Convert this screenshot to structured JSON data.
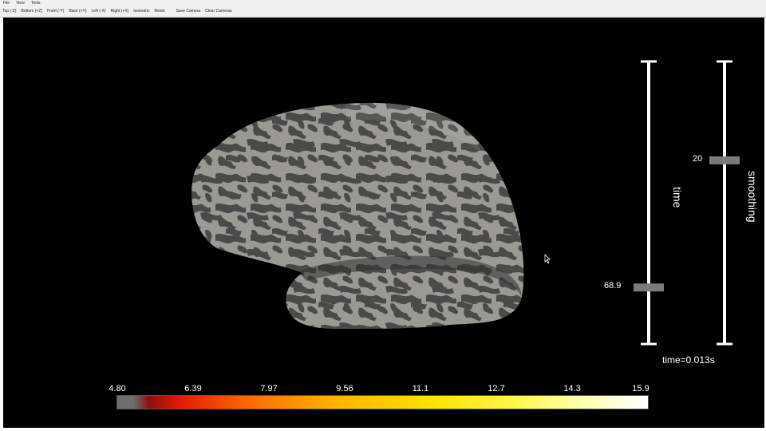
{
  "menu": [
    "File",
    "View",
    "Tools"
  ],
  "toolbar": [
    "Top (-Z)",
    "Bottom (+Z)",
    "Front (-Y)",
    "Back (+Y)",
    "Left (-X)",
    "Right (+X)",
    "Isometric",
    "Reset",
    "Save Camera",
    "Clear Cameras"
  ],
  "sliders": {
    "time": {
      "title": "time",
      "value_label": "68.9",
      "level": 0.2
    },
    "smoothing": {
      "title": "smoothing",
      "value_label": "20",
      "level": 0.65
    }
  },
  "time_text": "time=0.013s",
  "colorbar": {
    "ticks": [
      "4.80",
      "6.39",
      "7.97",
      "9.56",
      "11.1",
      "12.7",
      "14.3",
      "15.9"
    ],
    "colormap": [
      "#6e6e6e",
      "#8a1010",
      "#e81b00",
      "#ff6a00",
      "#ffb000",
      "#ffe400",
      "#fff64c",
      "#ffffff"
    ]
  },
  "colors": {
    "background": "#000000",
    "brain_light": "#9a9993",
    "brain_dark": "#4a4a48",
    "slider": "#ffffff",
    "handle": "#7a7a7a"
  }
}
